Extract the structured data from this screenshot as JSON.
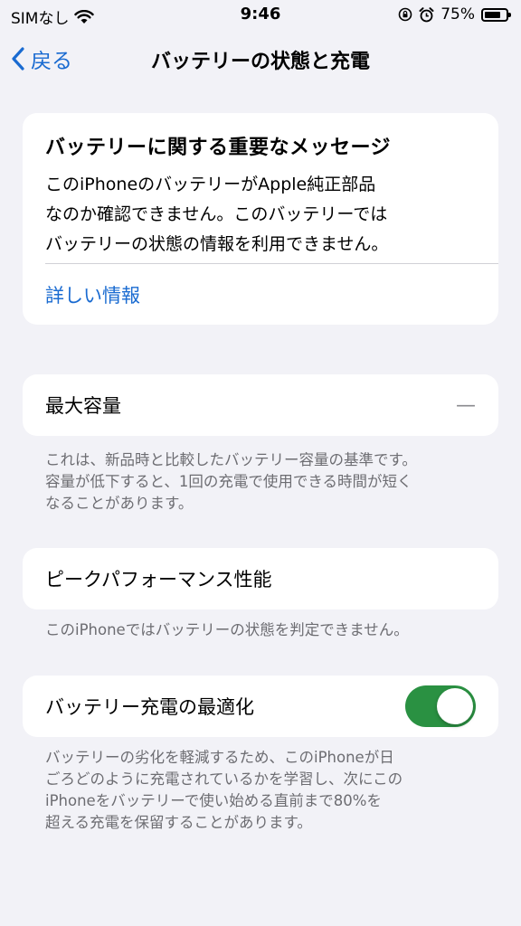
{
  "status_bar": {
    "carrier": "SIMなし",
    "time": "9:46",
    "battery_percent": "75%"
  },
  "nav": {
    "back_label": "戻る",
    "title": "バッテリーの状態と充電"
  },
  "message_card": {
    "title": "バッテリーに関する重要なメッセージ",
    "body_lines": [
      "このiPhoneのバッテリーがApple純正部品",
      "なのか確認できません。このバッテリーでは",
      "バッテリーの状態の情報を利用できません。"
    ],
    "link": "詳しい情報"
  },
  "max_capacity": {
    "label": "最大容量",
    "value": "—",
    "footer_lines": [
      "これは、新品時と比較したバッテリー容量の基準です。",
      "容量が低下すると、1回の充電で使用できる時間が短く",
      "なることがあります。"
    ]
  },
  "peak_performance": {
    "label": "ピークパフォーマンス性能",
    "footer": "このiPhoneではバッテリーの状態を判定できません。"
  },
  "optimized_charging": {
    "label": "バッテリー充電の最適化",
    "enabled": true,
    "toggle_color": "#2a9142",
    "footer_lines": [
      "バッテリーの劣化を軽減するため、このiPhoneが日",
      "ごろどのように充電されているかを学習し、次にこの",
      "iPhoneをバッテリーで使い始める直前まで80%を",
      "超える充電を保留することがあります。"
    ]
  }
}
